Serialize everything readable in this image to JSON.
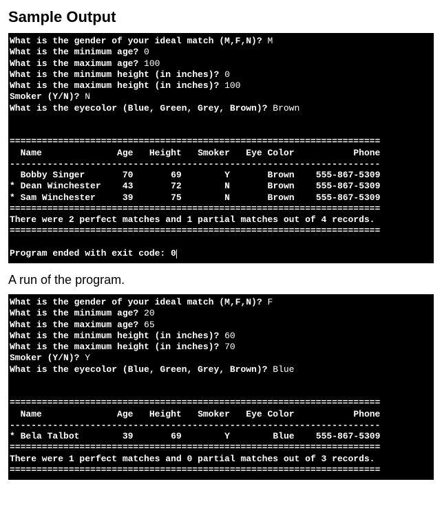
{
  "headings": {
    "sample_output": "Sample Output",
    "run_caption": "A run of the program."
  },
  "prompts": {
    "gender": "What is the gender of your ideal match (M,F,N)?",
    "min_age": "What is the minimum age?",
    "max_age": "What is the maximum age?",
    "min_height": "What is the minimum height (in inches)?",
    "max_height": "What is the maximum height (in inches)?",
    "smoker": "Smoker (Y/N)?",
    "eyecolor": "What is the eyecolor (Blue, Green, Grey, Brown)?"
  },
  "columns": {
    "name": "Name",
    "age": "Age",
    "height": "Height",
    "smoker": "Smoker",
    "eye": "Eye Color",
    "phone": "Phone"
  },
  "run1": {
    "inputs": {
      "gender": "M",
      "min_age": "0",
      "max_age": "100",
      "min_height": "0",
      "max_height": "100",
      "smoker": "N",
      "eyecolor": "Brown"
    },
    "rows": [
      {
        "mark": " ",
        "name": "Bobby Singer",
        "age": "70",
        "height": "69",
        "smoker": "Y",
        "eye": "Brown",
        "phone": "555-867-5309"
      },
      {
        "mark": "*",
        "name": "Dean Winchester",
        "age": "43",
        "height": "72",
        "smoker": "N",
        "eye": "Brown",
        "phone": "555-867-5309"
      },
      {
        "mark": "*",
        "name": "Sam Winchester",
        "age": "39",
        "height": "75",
        "smoker": "N",
        "eye": "Brown",
        "phone": "555-867-5309"
      }
    ],
    "summary": "There were 2 perfect matches and 1 partial matches out of 4 records.",
    "exit": "Program ended with exit code: 0"
  },
  "run2": {
    "inputs": {
      "gender": "F",
      "min_age": "20",
      "max_age": "65",
      "min_height": "60",
      "max_height": "70",
      "smoker": "Y",
      "eyecolor": "Blue"
    },
    "rows": [
      {
        "mark": "*",
        "name": "Bela Talbot",
        "age": "39",
        "height": "69",
        "smoker": "Y",
        "eye": "Blue",
        "phone": "555-867-5309"
      }
    ],
    "summary": "There were 1 perfect matches and 0 partial matches out of 3 records."
  },
  "divider": "=====================================================================",
  "dashline": "---------------------------------------------------------------------"
}
